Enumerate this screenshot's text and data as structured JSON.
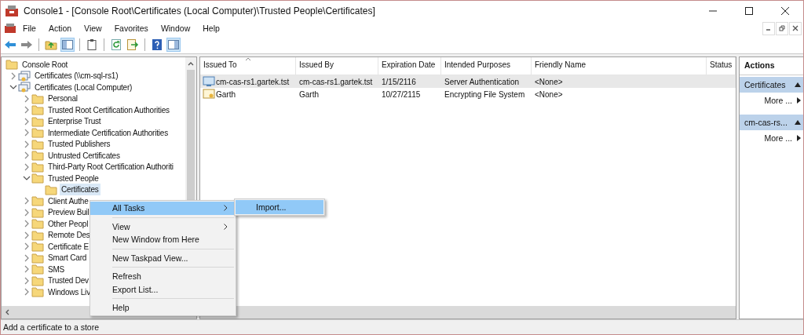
{
  "window": {
    "title": "Console1 - [Console Root\\Certificates (Local Computer)\\Trusted People\\Certificates]"
  },
  "menu_bar": [
    "File",
    "Action",
    "View",
    "Favorites",
    "Window",
    "Help"
  ],
  "toolbar": [
    [
      {
        "kind": "back",
        "pressed": false
      },
      {
        "kind": "forward",
        "pressed": false
      }
    ],
    [
      {
        "kind": "up",
        "pressed": false
      },
      {
        "kind": "tree_pane",
        "pressed": true
      }
    ],
    [
      {
        "kind": "properties",
        "pressed": false
      }
    ],
    [
      {
        "kind": "refresh",
        "pressed": false
      },
      {
        "kind": "export",
        "pressed": false
      }
    ],
    [
      {
        "kind": "help",
        "pressed": false
      },
      {
        "kind": "action_pane",
        "pressed": true
      }
    ]
  ],
  "tree": [
    {
      "label": "Console Root",
      "kind": "root",
      "expanded": true,
      "selected": false,
      "children": [
        {
          "label": "Certificates (\\\\cm-sql-rs1)",
          "kind": "store",
          "expanded": false,
          "selected": false
        },
        {
          "label": "Certificates (Local Computer)",
          "kind": "store",
          "expanded": true,
          "selected": false,
          "children": [
            {
              "label": "Personal",
              "kind": "folder",
              "expanded": false,
              "selected": false
            },
            {
              "label": "Trusted Root Certification Authorities",
              "kind": "folder",
              "expanded": false,
              "selected": false
            },
            {
              "label": "Enterprise Trust",
              "kind": "folder",
              "expanded": false,
              "selected": false
            },
            {
              "label": "Intermediate Certification Authorities",
              "kind": "folder",
              "expanded": false,
              "selected": false
            },
            {
              "label": "Trusted Publishers",
              "kind": "folder",
              "expanded": false,
              "selected": false
            },
            {
              "label": "Untrusted Certificates",
              "kind": "folder",
              "expanded": false,
              "selected": false
            },
            {
              "label": "Third-Party Root Certification Authoriti",
              "kind": "folder",
              "expanded": false,
              "selected": false
            },
            {
              "label": "Trusted People",
              "kind": "folder",
              "expanded": true,
              "selected": false,
              "children": [
                {
                  "label": "Certificates",
                  "kind": "leaf",
                  "selected": true
                }
              ]
            },
            {
              "label": "Client Authe",
              "kind": "folder",
              "expanded": false,
              "selected": false
            },
            {
              "label": "Preview Buil",
              "kind": "folder",
              "expanded": false,
              "selected": false
            },
            {
              "label": "Other Peopl",
              "kind": "folder",
              "expanded": false,
              "selected": false
            },
            {
              "label": "Remote Des",
              "kind": "folder",
              "expanded": false,
              "selected": false
            },
            {
              "label": "Certificate E",
              "kind": "folder",
              "expanded": false,
              "selected": false
            },
            {
              "label": "Smart Card",
              "kind": "folder",
              "expanded": false,
              "selected": false
            },
            {
              "label": "SMS",
              "kind": "folder",
              "expanded": false,
              "selected": false
            },
            {
              "label": "Trusted Dev",
              "kind": "folder",
              "expanded": false,
              "selected": false
            },
            {
              "label": "Windows Liv",
              "kind": "folder",
              "expanded": false,
              "selected": false
            }
          ]
        }
      ]
    }
  ],
  "list": {
    "columns": [
      {
        "label": "Issued To",
        "sorted": true
      },
      {
        "label": "Issued By",
        "sorted": false
      },
      {
        "label": "Expiration Date",
        "sorted": false
      },
      {
        "label": "Intended Purposes",
        "sorted": false
      },
      {
        "label": "Friendly Name",
        "sorted": false
      },
      {
        "label": "Status",
        "sorted": false
      }
    ],
    "rows": [
      {
        "kind": "computer",
        "selected": true,
        "cells": [
          "cm-cas-rs1.gartek.tst",
          "cm-cas-rs1.gartek.tst",
          "1/15/2116",
          "Server Authentication",
          "<None>"
        ]
      },
      {
        "kind": "user",
        "selected": false,
        "cells": [
          "Garth",
          "Garth",
          "10/27/2115",
          "Encrypting File System",
          "<None>"
        ]
      }
    ]
  },
  "actions": {
    "title": "Actions",
    "sections": [
      {
        "title": "Certificates",
        "items": [
          "More ..."
        ]
      },
      {
        "title": "cm-cas-rs...",
        "items": [
          "More ..."
        ]
      }
    ]
  },
  "context_menu": {
    "items": [
      {
        "kind": "item",
        "label": "All Tasks",
        "submenu": true,
        "selected": true
      },
      {
        "kind": "separator"
      },
      {
        "kind": "item",
        "label": "View",
        "submenu": true,
        "selected": false
      },
      {
        "kind": "item",
        "label": "New Window from Here",
        "submenu": false,
        "selected": false
      },
      {
        "kind": "separator"
      },
      {
        "kind": "item",
        "label": "New Taskpad View...",
        "submenu": false,
        "selected": false
      },
      {
        "kind": "separator"
      },
      {
        "kind": "item",
        "label": "Refresh",
        "submenu": false,
        "selected": false
      },
      {
        "kind": "item",
        "label": "Export List...",
        "submenu": false,
        "selected": false
      },
      {
        "kind": "separator"
      },
      {
        "kind": "item",
        "label": "Help",
        "submenu": false,
        "selected": false
      }
    ]
  },
  "submenu": {
    "items": [
      {
        "label": "Import...",
        "selected": true
      }
    ]
  },
  "status_bar": "Add a certificate to a store"
}
